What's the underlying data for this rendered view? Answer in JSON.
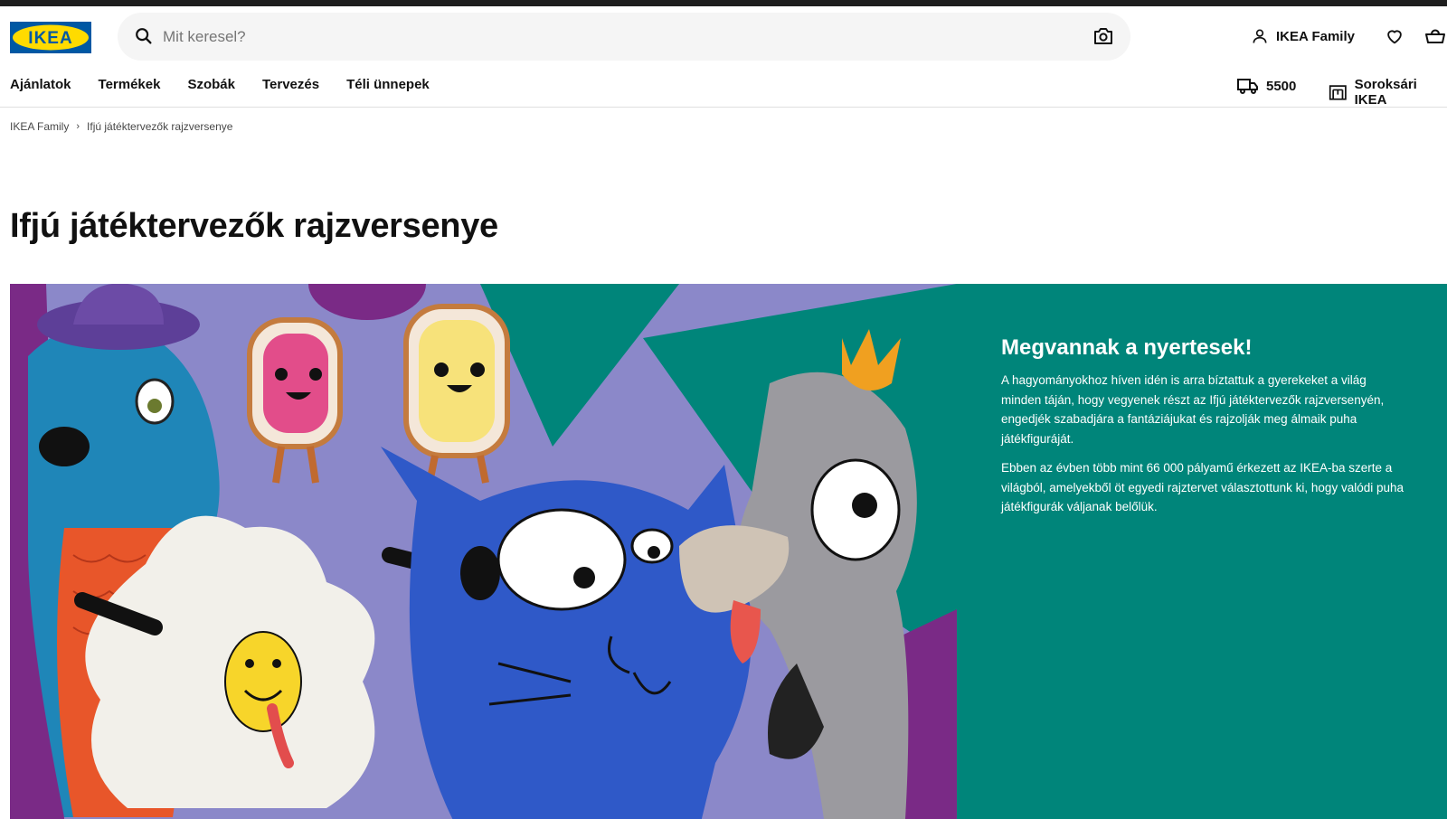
{
  "header": {
    "logo_text": "IKEA",
    "search_placeholder": "Mit keresel?",
    "family_label": "IKEA Family"
  },
  "nav": {
    "items": [
      "Ajánlatok",
      "Termékek",
      "Szobák",
      "Tervezés",
      "Téli ünnepek"
    ],
    "delivery_code": "5500",
    "store_label": "Soroksári IKEA"
  },
  "breadcrumb": {
    "items": [
      "IKEA Family",
      "Ifjú játéktervezők rajzversenye"
    ]
  },
  "page": {
    "title": "Ifjú játéktervezők rajzversenye"
  },
  "hero": {
    "heading": "Megvannak a nyertesek!",
    "paragraph1": "A hagyományokhoz híven idén is arra bíztattuk a gyerekeket a világ minden táján, hogy vegyenek részt az Ifjú játéktervezők rajzversenyén, engedjék szabadjára a fantáziájukat és rajzolják meg álmaik puha játékfiguráját.",
    "paragraph2": "Ebben az évben több mint 66 000 pályamű érkezett az IKEA-ba szerte a világból, amelyekből öt egyedi rajztervet választottunk ki, hogy valódi puha játékfigurák váljanak belőlük."
  },
  "colors": {
    "ikea_blue": "#0058a3",
    "ikea_yellow": "#ffdb00",
    "hero_panel": "#00857a",
    "hero_bg": "#8b88c9"
  }
}
